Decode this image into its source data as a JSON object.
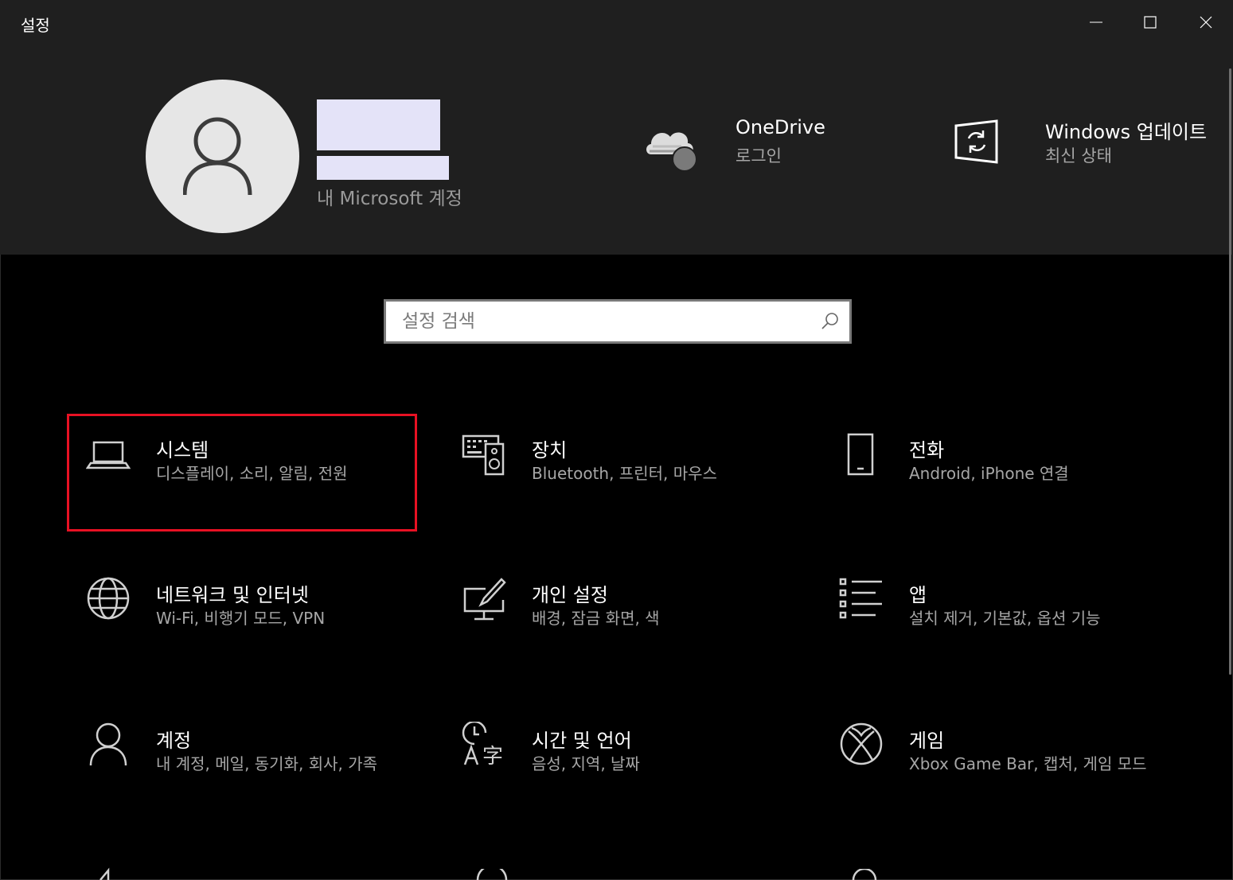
{
  "window": {
    "title": "설정"
  },
  "header": {
    "account_link": "내 Microsoft 계정",
    "onedrive": {
      "title": "OneDrive",
      "subtitle": "로그인"
    },
    "update": {
      "title": "Windows 업데이트",
      "subtitle": "최신 상태"
    }
  },
  "search": {
    "placeholder": "설정 검색"
  },
  "tiles": [
    {
      "id": "system",
      "title": "시스템",
      "subtitle": "디스플레이, 소리, 알림, 전원",
      "icon": "laptop-icon",
      "selected": true
    },
    {
      "id": "devices",
      "title": "장치",
      "subtitle": "Bluetooth, 프린터, 마우스",
      "icon": "devices-icon"
    },
    {
      "id": "phone",
      "title": "전화",
      "subtitle": "Android, iPhone 연결",
      "icon": "phone-icon"
    },
    {
      "id": "network",
      "title": "네트워크 및 인터넷",
      "subtitle": "Wi-Fi, 비행기 모드, VPN",
      "icon": "globe-icon"
    },
    {
      "id": "personalization",
      "title": "개인 설정",
      "subtitle": "배경, 잠금 화면, 색",
      "icon": "paint-icon"
    },
    {
      "id": "apps",
      "title": "앱",
      "subtitle": "설치 제거, 기본값, 옵션 기능",
      "icon": "apps-list-icon"
    },
    {
      "id": "accounts",
      "title": "계정",
      "subtitle": "내 계정, 메일, 동기화, 회사, 가족",
      "icon": "person-icon"
    },
    {
      "id": "time-language",
      "title": "시간 및 언어",
      "subtitle": "음성, 지역, 날짜",
      "icon": "time-language-icon"
    },
    {
      "id": "gaming",
      "title": "게임",
      "subtitle": "Xbox Game Bar, 캡처, 게임 모드",
      "icon": "xbox-icon"
    }
  ],
  "colors": {
    "accent_selection": "#e81123",
    "header_bg": "#1f1f1f",
    "body_bg": "#000000"
  }
}
